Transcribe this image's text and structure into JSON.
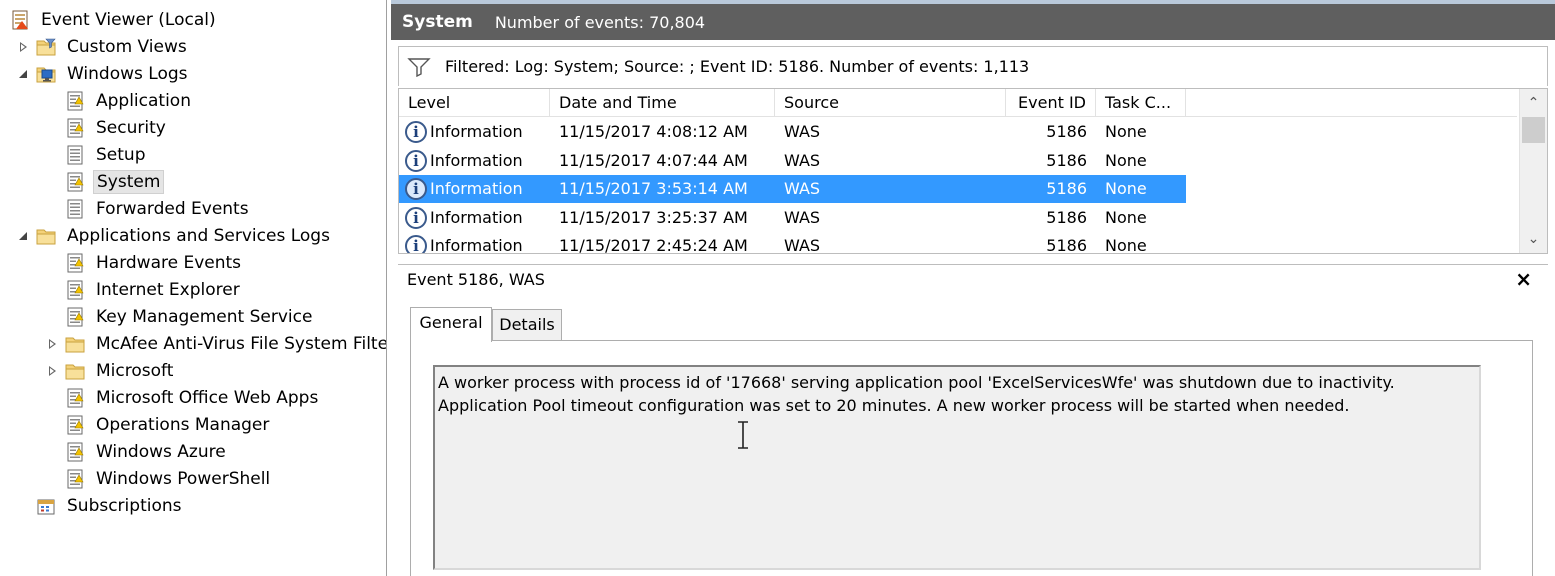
{
  "tree": {
    "root": {
      "label": "Event Viewer (Local)",
      "icon": "event-viewer-icon"
    },
    "items": [
      {
        "label": "Custom Views",
        "expander": "collapsed",
        "icon": "folder-filter-icon"
      },
      {
        "label": "Windows Logs",
        "expander": "expanded",
        "icon": "windows-logs-icon"
      },
      {
        "label": "Application",
        "icon": "log-warning-icon"
      },
      {
        "label": "Security",
        "icon": "log-warning-icon"
      },
      {
        "label": "Setup",
        "icon": "log-icon"
      },
      {
        "label": "System",
        "icon": "log-warning-icon",
        "selected": true
      },
      {
        "label": "Forwarded Events",
        "icon": "log-icon"
      },
      {
        "label": "Applications and Services Logs",
        "expander": "expanded",
        "icon": "folder-icon"
      },
      {
        "label": "Hardware Events",
        "icon": "log-warning-icon"
      },
      {
        "label": "Internet Explorer",
        "icon": "log-warning-icon"
      },
      {
        "label": "Key Management Service",
        "icon": "log-warning-icon"
      },
      {
        "label": "McAfee Anti-Virus File System Filter",
        "expander": "collapsed",
        "icon": "folder-icon"
      },
      {
        "label": "Microsoft",
        "expander": "collapsed",
        "icon": "folder-icon"
      },
      {
        "label": "Microsoft Office Web Apps",
        "icon": "log-warning-icon"
      },
      {
        "label": "Operations Manager",
        "icon": "log-warning-icon"
      },
      {
        "label": "Windows Azure",
        "icon": "log-warning-icon"
      },
      {
        "label": "Windows PowerShell",
        "icon": "log-warning-icon"
      },
      {
        "label": "Subscriptions",
        "icon": "subscriptions-icon"
      }
    ]
  },
  "header": {
    "title": "System",
    "count": "Number of events: 70,804"
  },
  "filter": {
    "text": "Filtered: Log: System; Source: ; Event ID: 5186. Number of events: 1,113",
    "icon": "filter-icon"
  },
  "grid": {
    "columns": [
      "Level",
      "Date and Time",
      "Source",
      "Event ID",
      "Task C..."
    ],
    "rows": [
      {
        "level": "Information",
        "date": "11/15/2017 4:08:12 AM",
        "source": "WAS",
        "id": "5186",
        "task": "None"
      },
      {
        "level": "Information",
        "date": "11/15/2017 4:07:44 AM",
        "source": "WAS",
        "id": "5186",
        "task": "None"
      },
      {
        "level": "Information",
        "date": "11/15/2017 3:53:14 AM",
        "source": "WAS",
        "id": "5186",
        "task": "None",
        "selected": true
      },
      {
        "level": "Information",
        "date": "11/15/2017 3:25:37 AM",
        "source": "WAS",
        "id": "5186",
        "task": "None"
      },
      {
        "level": "Information",
        "date": "11/15/2017 2:45:24 AM",
        "source": "WAS",
        "id": "5186",
        "task": "None"
      }
    ]
  },
  "detail": {
    "title": "Event 5186, WAS",
    "close": "×",
    "tabs": [
      "General",
      "Details"
    ],
    "description": "A worker process with process id of '17668' serving application pool 'ExcelServicesWfe' was shutdown due to inactivity.  Application Pool timeout configuration was set to 20 minutes.  A new worker process will be started when needed."
  },
  "colors": {
    "header_bg": "#5f5f5f",
    "selection": "#3399ff",
    "info_icon": "#3a5a8c"
  }
}
